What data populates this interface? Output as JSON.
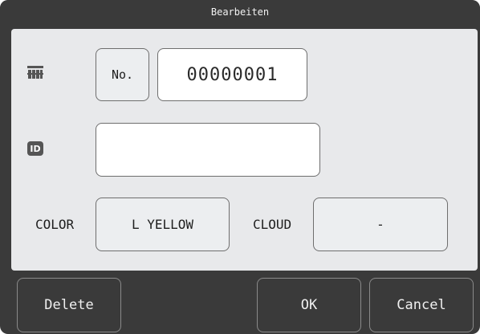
{
  "dialog": {
    "title": "Bearbeiten"
  },
  "rack": {
    "icon": "rack-icon",
    "no_button_label": "No.",
    "number_value": "00000001"
  },
  "id": {
    "icon": "id-badge-icon",
    "icon_text": "ID",
    "value": ""
  },
  "color": {
    "label": "COLOR",
    "value": "L YELLOW"
  },
  "cloud": {
    "label": "CLOUD",
    "value": "-"
  },
  "footer": {
    "delete_label": "Delete",
    "ok_label": "OK",
    "cancel_label": "Cancel"
  },
  "colors": {
    "frame": "#3a3a3a",
    "panel": "#e8e9eb",
    "field": "#ffffff",
    "button": "#eceef0"
  }
}
